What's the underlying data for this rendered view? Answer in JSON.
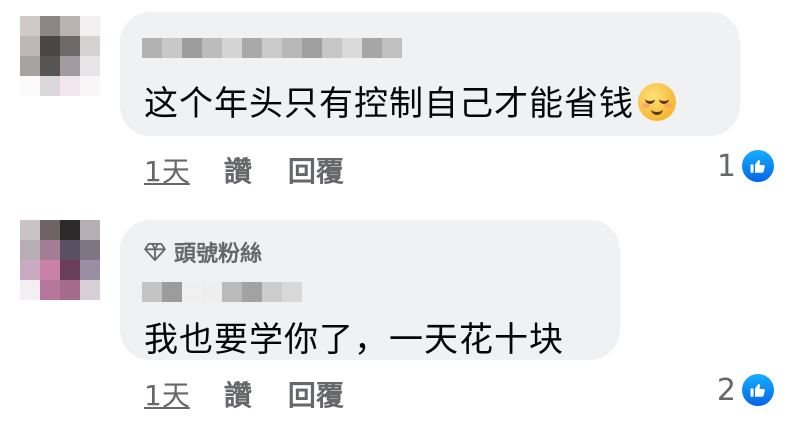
{
  "comments": [
    {
      "text": "这个年头只有控制自己才能省钱",
      "emoji": "relieved-face",
      "time": "1天",
      "like_label": "讚",
      "reply_label": "回覆",
      "reaction_count": "1"
    },
    {
      "badge": "頭號粉絲",
      "badge_icon": "diamond-icon",
      "text": "我也要学你了，一天花十块",
      "time": "1天",
      "like_label": "讚",
      "reply_label": "回覆",
      "reaction_count": "2"
    }
  ],
  "colors": {
    "bubble": "#eff1f3",
    "meta_text": "#65676b",
    "like_blue": "#0866ff"
  }
}
